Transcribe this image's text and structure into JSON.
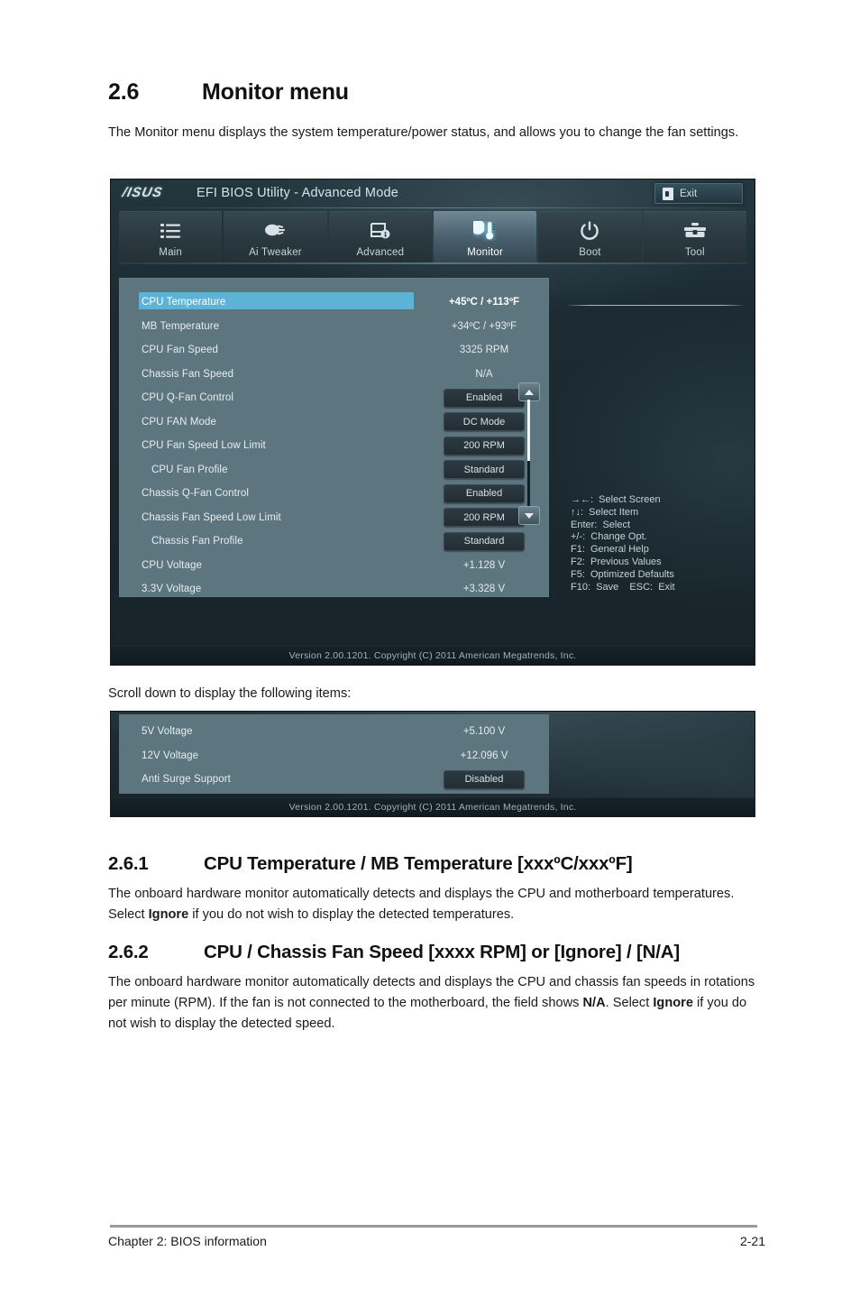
{
  "document": {
    "section_number": "2.6",
    "section_title": "Monitor menu",
    "intro": "The Monitor menu displays the system temperature/power status, and allows you to change the fan settings.",
    "scroll_note": "Scroll down to display the following items:",
    "sub_sections": [
      {
        "number": "2.6.1",
        "title": "CPU Temperature / MB Temperature [xxxºC/xxxºF]",
        "body_pre": "The onboard hardware monitor automatically detects and displays the CPU and motherboard temperatures. Select ",
        "body_bold": "Ignore",
        "body_post": " if you do not wish to display the detected temperatures."
      },
      {
        "number": "2.6.2",
        "title": "CPU / Chassis Fan Speed [xxxx RPM] or [Ignore] / [N/A]",
        "body_pre": "The onboard hardware monitor automatically detects and displays the CPU and chassis fan speeds in rotations per minute (RPM). If the fan is not connected to the motherboard, the field shows ",
        "body_bold": "N/A",
        "body_mid": ". Select ",
        "body_bold2": "Ignore",
        "body_post": " if you do not wish to display the detected speed."
      }
    ],
    "footer": {
      "left": "Chapter 2: BIOS information",
      "page": "2-21"
    }
  },
  "bios": {
    "brand": "/ISUS",
    "title": "EFI BIOS Utility - Advanced Mode",
    "exit_label": "Exit",
    "exit_icon": "exit-door-icon",
    "tabs": [
      {
        "label": "Main",
        "icon": "list-icon",
        "active": false
      },
      {
        "label": "Ai  Tweaker",
        "icon": "tweaker-icon",
        "active": false
      },
      {
        "label": "Advanced",
        "icon": "monitor-info-icon",
        "active": false
      },
      {
        "label": "Monitor",
        "icon": "thermometer-icon",
        "active": true
      },
      {
        "label": "Boot",
        "icon": "power-icon",
        "active": false
      },
      {
        "label": "Tool",
        "icon": "toolbox-icon",
        "active": false
      }
    ],
    "items": [
      {
        "label": "CPU Temperature",
        "value": "+45ºC / +113ºF",
        "type": "text",
        "selected": true,
        "indent": false
      },
      {
        "label": "MB Temperature",
        "value": "+34ºC / +93ºF",
        "type": "text",
        "selected": false,
        "indent": false
      },
      {
        "label": "CPU Fan Speed",
        "value": "3325 RPM",
        "type": "text",
        "selected": false,
        "indent": false
      },
      {
        "label": "Chassis Fan Speed",
        "value": "N/A",
        "type": "text",
        "selected": false,
        "indent": false
      },
      {
        "label": "CPU Q-Fan Control",
        "value": "Enabled",
        "type": "option",
        "selected": false,
        "indent": false
      },
      {
        "label": "CPU FAN Mode",
        "value": "DC Mode",
        "type": "option",
        "selected": false,
        "indent": false
      },
      {
        "label": "CPU Fan Speed Low Limit",
        "value": "200 RPM",
        "type": "option",
        "selected": false,
        "indent": false
      },
      {
        "label": "CPU Fan Profile",
        "value": "Standard",
        "type": "option",
        "selected": false,
        "indent": true
      },
      {
        "label": "Chassis Q-Fan Control",
        "value": "Enabled",
        "type": "option",
        "selected": false,
        "indent": false
      },
      {
        "label": "Chassis Fan Speed Low Limit",
        "value": "200 RPM",
        "type": "option",
        "selected": false,
        "indent": false
      },
      {
        "label": "Chassis Fan Profile",
        "value": "Standard",
        "type": "option",
        "selected": false,
        "indent": true
      },
      {
        "label": "CPU Voltage",
        "value": "+1.128 V",
        "type": "text",
        "selected": false,
        "indent": false
      },
      {
        "label": "3.3V Voltage",
        "value": "+3.328 V",
        "type": "text",
        "selected": false,
        "indent": false
      }
    ],
    "items_scrolled": [
      {
        "label": "5V Voltage",
        "value": "+5.100 V",
        "type": "text",
        "selected": false,
        "indent": false
      },
      {
        "label": "12V Voltage",
        "value": "+12.096 V",
        "type": "text",
        "selected": false,
        "indent": false
      },
      {
        "label": "Anti Surge Support",
        "value": "Disabled",
        "type": "option",
        "selected": false,
        "indent": false
      }
    ],
    "key_legend": [
      "→←:  Select Screen",
      "↑↓:  Select Item",
      "Enter:  Select",
      "+/-:  Change Opt.",
      "F1:  General Help",
      "F2:  Previous Values",
      "F5:  Optimized Defaults",
      "F10:  Save    ESC:  Exit"
    ],
    "version_footer": "Version  2.00.1201.   Copyright  (C)  2011  American  Megatrends,  Inc.",
    "colors": {
      "panel_bg": "#5c757f",
      "window_bg": "#1c2b32",
      "highlight": "#5cb3d6",
      "accent_text": "#cfe6ef",
      "option_box": "#2d3a43"
    }
  }
}
